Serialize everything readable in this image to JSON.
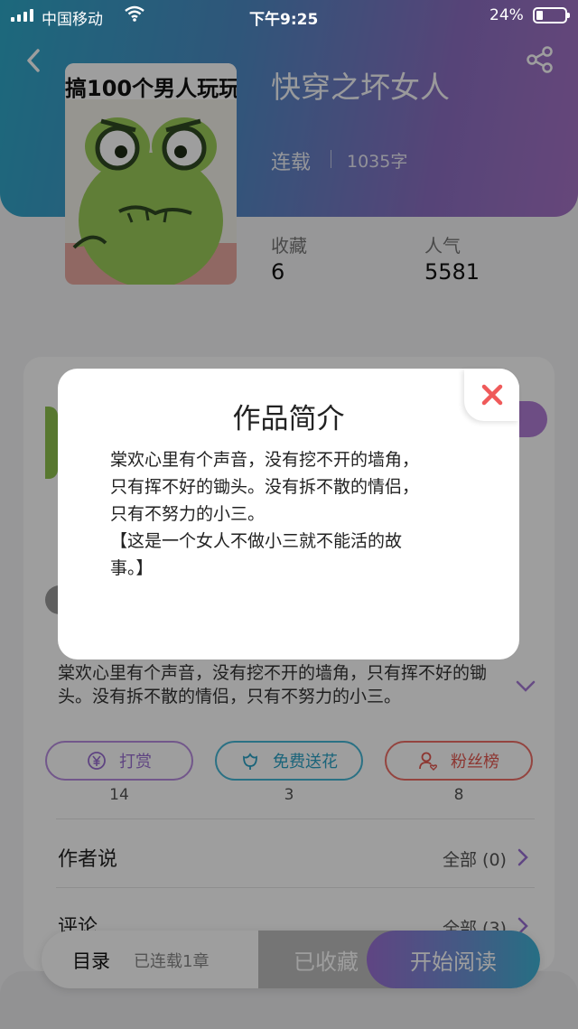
{
  "status_bar": {
    "carrier": "中国移动",
    "time": "下午9:25",
    "battery": "24%"
  },
  "book": {
    "cover_banner": "搞100个男人玩玩",
    "title": "快穿之坏女人",
    "serial_status": "连载",
    "word_count": "1035字",
    "stats": [
      {
        "label": "收藏",
        "value": "6"
      },
      {
        "label": "人气",
        "value": "5581"
      }
    ],
    "summary": "棠欢心里有个声音，没有挖不开的墙角，只有挥不好的锄头。没有拆不散的情侣，只有不努力的小三。"
  },
  "actions": [
    {
      "label": "打赏",
      "count": "14",
      "icon": "yen-icon"
    },
    {
      "label": "免费送花",
      "count": "3",
      "icon": "flower-icon"
    },
    {
      "label": "粉丝榜",
      "count": "8",
      "icon": "fans-icon"
    }
  ],
  "sections": {
    "author": {
      "title": "作者说",
      "link": "全部 (0)"
    },
    "comments": {
      "title": "评论",
      "link": "全部 (3)"
    }
  },
  "bottom_bar": {
    "toc": "目录",
    "chapters": "已连载1章",
    "favorited": "已收藏",
    "start_reading": "开始阅读"
  },
  "modal": {
    "title": "作品简介",
    "body": "棠欢心里有个声音，没有挖不开的墙角，\n只有挥不好的锄头。没有拆不散的情侣，\n只有不努力的小三。\n【这是一个女人不做小三就不能活的故\n事。】"
  },
  "colors": {
    "header_gradient": [
      "#2ea9c9",
      "#a673c6"
    ],
    "reward": "#9a6fd2",
    "flower": "#2aa2c6",
    "fans": "#e4574f",
    "close": "#ef5a5a"
  }
}
